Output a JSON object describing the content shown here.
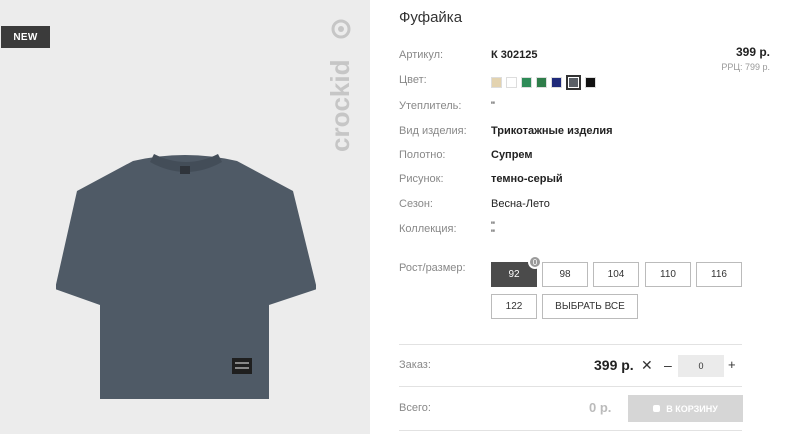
{
  "badge": "NEW",
  "brand": "crockid",
  "product": {
    "title": "Фуфайка",
    "price": "399 р.",
    "rrp": "РРЦ: 799 р."
  },
  "specs": [
    {
      "label": "Артикул:",
      "value": "К 302125"
    },
    {
      "label": "Цвет:",
      "value": ""
    },
    {
      "label": "Утеплитель:",
      "value": "\""
    },
    {
      "label": "Вид изделия:",
      "value": "Трикотажные изделия"
    },
    {
      "label": "Полотно:",
      "value": "Супрем"
    },
    {
      "label": "Рисунок:",
      "value": "темно-серый"
    },
    {
      "label": "Сезон:",
      "value": "Весна-Лето"
    },
    {
      "label": "Коллекция:",
      "value": "\"\n\""
    }
  ],
  "colors": [
    "#e3d3b0",
    "#ffffff",
    "#2e8b57",
    "#2f7d4a",
    "#1f2a7a",
    "#5a5f66",
    "#111111"
  ],
  "selected_color": "#5a5f66",
  "sizes": {
    "label": "Рост/размер:",
    "options": [
      "92",
      "98",
      "104",
      "110",
      "116",
      "122"
    ],
    "select_all": "ВЫБРАТЬ ВСЕ",
    "active": "92",
    "count": "0"
  },
  "order": {
    "label": "Заказ:",
    "price": "399 р.",
    "times": "✕",
    "minus": "–",
    "qty": "0",
    "plus": "+"
  },
  "total": {
    "label": "Всего:",
    "value": "0 р.",
    "cart_label": "В КОРЗИНУ"
  }
}
